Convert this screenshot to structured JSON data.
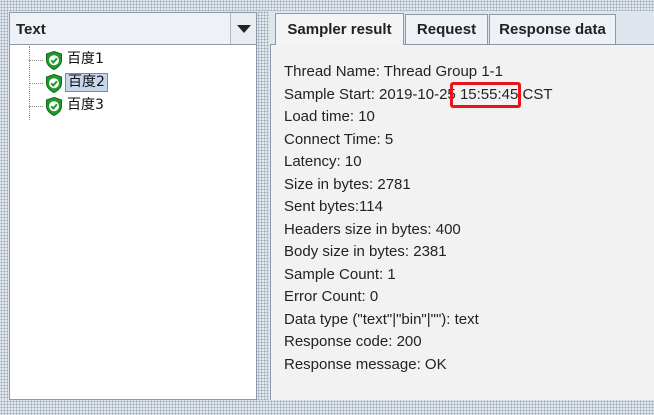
{
  "left_panel": {
    "renderer_select": {
      "value": "Text"
    },
    "tree_items": [
      {
        "label": "百度1",
        "status": "success",
        "selected": false
      },
      {
        "label": "百度2",
        "status": "success",
        "selected": true
      },
      {
        "label": "百度3",
        "status": "success",
        "selected": false
      }
    ]
  },
  "tabs": [
    {
      "label": "Sampler result",
      "active": true
    },
    {
      "label": "Request",
      "active": false
    },
    {
      "label": "Response data",
      "active": false
    }
  ],
  "sampler_result": {
    "thread_name": "Thread Name: Thread Group 1-1",
    "sample_start_prefix": "Sample Start: 2019-10-25 ",
    "sample_start_time": "15:55:45",
    "sample_start_suffix": " CST",
    "load_time": "Load time: 10",
    "connect_time": "Connect Time: 5",
    "latency": "Latency: 10",
    "size_in_bytes": "Size in bytes: 2781",
    "sent_bytes": "Sent bytes:114",
    "headers_size": "Headers size in bytes: 400",
    "body_size": "Body size in bytes: 2381",
    "sample_count": "Sample Count: 1",
    "error_count": "Error Count: 0",
    "data_type": "Data type (\"text\"|\"bin\"|\"\"): text",
    "response_code": "Response code: 200",
    "response_message": "Response message: OK"
  },
  "colors": {
    "highlight_border": "#e8141a",
    "success_shield": "#1f9a2c",
    "selection": "#c5d7ec"
  },
  "icons": {
    "tree_item_icon": "green-shield-check-icon",
    "dropdown_icon": "triangle-down-icon"
  }
}
